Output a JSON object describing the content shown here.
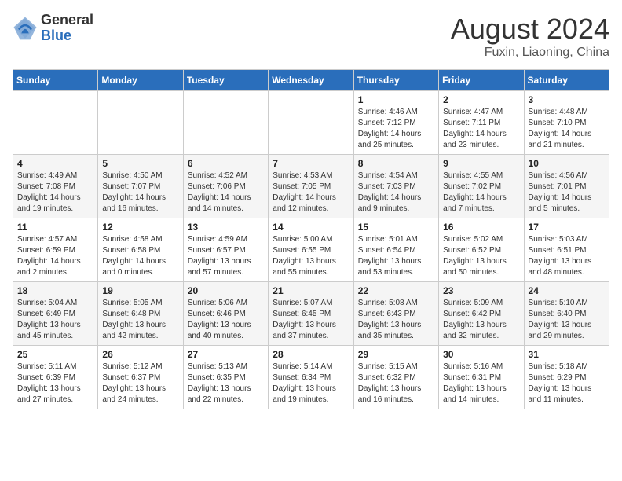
{
  "logo": {
    "general": "General",
    "blue": "Blue"
  },
  "title": {
    "month_year": "August 2024",
    "location": "Fuxin, Liaoning, China"
  },
  "weekdays": [
    "Sunday",
    "Monday",
    "Tuesday",
    "Wednesday",
    "Thursday",
    "Friday",
    "Saturday"
  ],
  "weeks": [
    [
      {
        "day": "",
        "info": ""
      },
      {
        "day": "",
        "info": ""
      },
      {
        "day": "",
        "info": ""
      },
      {
        "day": "",
        "info": ""
      },
      {
        "day": "1",
        "info": "Sunrise: 4:46 AM\nSunset: 7:12 PM\nDaylight: 14 hours\nand 25 minutes."
      },
      {
        "day": "2",
        "info": "Sunrise: 4:47 AM\nSunset: 7:11 PM\nDaylight: 14 hours\nand 23 minutes."
      },
      {
        "day": "3",
        "info": "Sunrise: 4:48 AM\nSunset: 7:10 PM\nDaylight: 14 hours\nand 21 minutes."
      }
    ],
    [
      {
        "day": "4",
        "info": "Sunrise: 4:49 AM\nSunset: 7:08 PM\nDaylight: 14 hours\nand 19 minutes."
      },
      {
        "day": "5",
        "info": "Sunrise: 4:50 AM\nSunset: 7:07 PM\nDaylight: 14 hours\nand 16 minutes."
      },
      {
        "day": "6",
        "info": "Sunrise: 4:52 AM\nSunset: 7:06 PM\nDaylight: 14 hours\nand 14 minutes."
      },
      {
        "day": "7",
        "info": "Sunrise: 4:53 AM\nSunset: 7:05 PM\nDaylight: 14 hours\nand 12 minutes."
      },
      {
        "day": "8",
        "info": "Sunrise: 4:54 AM\nSunset: 7:03 PM\nDaylight: 14 hours\nand 9 minutes."
      },
      {
        "day": "9",
        "info": "Sunrise: 4:55 AM\nSunset: 7:02 PM\nDaylight: 14 hours\nand 7 minutes."
      },
      {
        "day": "10",
        "info": "Sunrise: 4:56 AM\nSunset: 7:01 PM\nDaylight: 14 hours\nand 5 minutes."
      }
    ],
    [
      {
        "day": "11",
        "info": "Sunrise: 4:57 AM\nSunset: 6:59 PM\nDaylight: 14 hours\nand 2 minutes."
      },
      {
        "day": "12",
        "info": "Sunrise: 4:58 AM\nSunset: 6:58 PM\nDaylight: 14 hours\nand 0 minutes."
      },
      {
        "day": "13",
        "info": "Sunrise: 4:59 AM\nSunset: 6:57 PM\nDaylight: 13 hours\nand 57 minutes."
      },
      {
        "day": "14",
        "info": "Sunrise: 5:00 AM\nSunset: 6:55 PM\nDaylight: 13 hours\nand 55 minutes."
      },
      {
        "day": "15",
        "info": "Sunrise: 5:01 AM\nSunset: 6:54 PM\nDaylight: 13 hours\nand 53 minutes."
      },
      {
        "day": "16",
        "info": "Sunrise: 5:02 AM\nSunset: 6:52 PM\nDaylight: 13 hours\nand 50 minutes."
      },
      {
        "day": "17",
        "info": "Sunrise: 5:03 AM\nSunset: 6:51 PM\nDaylight: 13 hours\nand 48 minutes."
      }
    ],
    [
      {
        "day": "18",
        "info": "Sunrise: 5:04 AM\nSunset: 6:49 PM\nDaylight: 13 hours\nand 45 minutes."
      },
      {
        "day": "19",
        "info": "Sunrise: 5:05 AM\nSunset: 6:48 PM\nDaylight: 13 hours\nand 42 minutes."
      },
      {
        "day": "20",
        "info": "Sunrise: 5:06 AM\nSunset: 6:46 PM\nDaylight: 13 hours\nand 40 minutes."
      },
      {
        "day": "21",
        "info": "Sunrise: 5:07 AM\nSunset: 6:45 PM\nDaylight: 13 hours\nand 37 minutes."
      },
      {
        "day": "22",
        "info": "Sunrise: 5:08 AM\nSunset: 6:43 PM\nDaylight: 13 hours\nand 35 minutes."
      },
      {
        "day": "23",
        "info": "Sunrise: 5:09 AM\nSunset: 6:42 PM\nDaylight: 13 hours\nand 32 minutes."
      },
      {
        "day": "24",
        "info": "Sunrise: 5:10 AM\nSunset: 6:40 PM\nDaylight: 13 hours\nand 29 minutes."
      }
    ],
    [
      {
        "day": "25",
        "info": "Sunrise: 5:11 AM\nSunset: 6:39 PM\nDaylight: 13 hours\nand 27 minutes."
      },
      {
        "day": "26",
        "info": "Sunrise: 5:12 AM\nSunset: 6:37 PM\nDaylight: 13 hours\nand 24 minutes."
      },
      {
        "day": "27",
        "info": "Sunrise: 5:13 AM\nSunset: 6:35 PM\nDaylight: 13 hours\nand 22 minutes."
      },
      {
        "day": "28",
        "info": "Sunrise: 5:14 AM\nSunset: 6:34 PM\nDaylight: 13 hours\nand 19 minutes."
      },
      {
        "day": "29",
        "info": "Sunrise: 5:15 AM\nSunset: 6:32 PM\nDaylight: 13 hours\nand 16 minutes."
      },
      {
        "day": "30",
        "info": "Sunrise: 5:16 AM\nSunset: 6:31 PM\nDaylight: 13 hours\nand 14 minutes."
      },
      {
        "day": "31",
        "info": "Sunrise: 5:18 AM\nSunset: 6:29 PM\nDaylight: 13 hours\nand 11 minutes."
      }
    ]
  ]
}
